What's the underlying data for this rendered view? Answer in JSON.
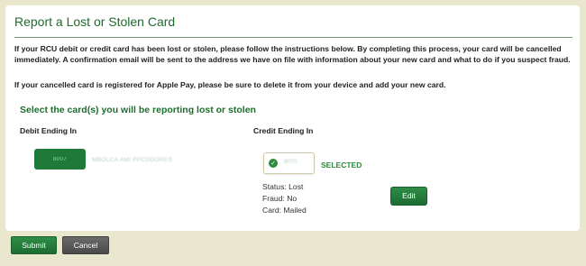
{
  "page": {
    "title": "Report a Lost or Stolen Card",
    "paragraph1": "If your RCU debit or credit card has been lost or stolen, please follow the instructions below. By completing this process, your card will be cancelled immediately. A confirmation email will be sent to the address we have on file with information about your new card and what to do if you suspect fraud.",
    "paragraph2": "If your cancelled card is registered for Apple Pay, please be sure to delete it from your device and add your new card.",
    "section_heading": "Select the card(s) you will be reporting lost or stolen"
  },
  "debit": {
    "column_label": "Debit Ending In",
    "card_number_masked": "8007",
    "cardholder_masked": "MBOLCA AMI PPCDDORES"
  },
  "credit": {
    "column_label": "Credit Ending In",
    "card_number_masked": "8070",
    "selected_label": "SELECTED",
    "status": "Status: Lost",
    "fraud": "Fraud: No",
    "card": "Card: Mailed",
    "edit_label": "Edit"
  },
  "actions": {
    "submit_label": "Submit",
    "cancel_label": "Cancel"
  },
  "colors": {
    "accent_green": "#1f6b2c",
    "button_green": "#1c6c31",
    "button_gray": "#4a4a4a",
    "background": "#e9e8cf"
  }
}
